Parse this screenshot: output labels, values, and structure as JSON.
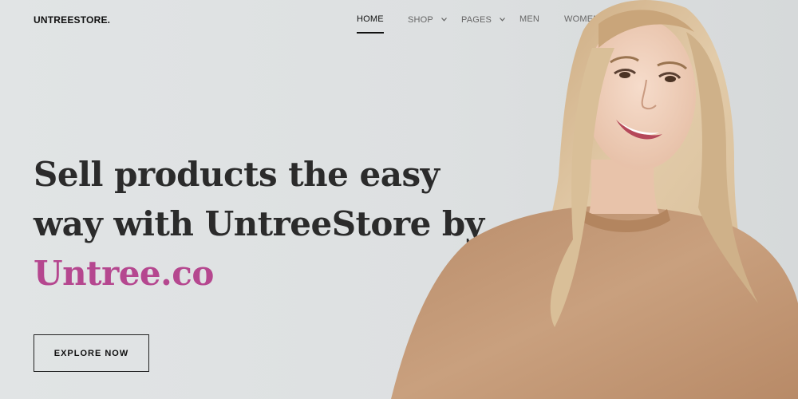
{
  "header": {
    "logo": "UNTREESTORE",
    "logo_dot": ".",
    "nav": [
      {
        "label": "HOME",
        "active": true,
        "dropdown": false
      },
      {
        "label": "SHOP",
        "active": false,
        "dropdown": true
      },
      {
        "label": "PAGES",
        "active": false,
        "dropdown": true
      },
      {
        "label": "MEN",
        "active": false,
        "dropdown": false
      },
      {
        "label": "WOMEN",
        "active": false,
        "dropdown": false
      }
    ]
  },
  "hero": {
    "line1": "Sell products the easy",
    "line2": "way with UntreeStore by",
    "line3": "Untree.co",
    "cta_label": "EXPLORE NOW"
  },
  "colors": {
    "background": "#dfe2e3",
    "accent": "#b5478f",
    "text": "#2b2b2b",
    "sweater": "#c99f7d",
    "hair": "#dcc3a0"
  },
  "icons": {
    "dropdown": "chevron-down-icon"
  }
}
